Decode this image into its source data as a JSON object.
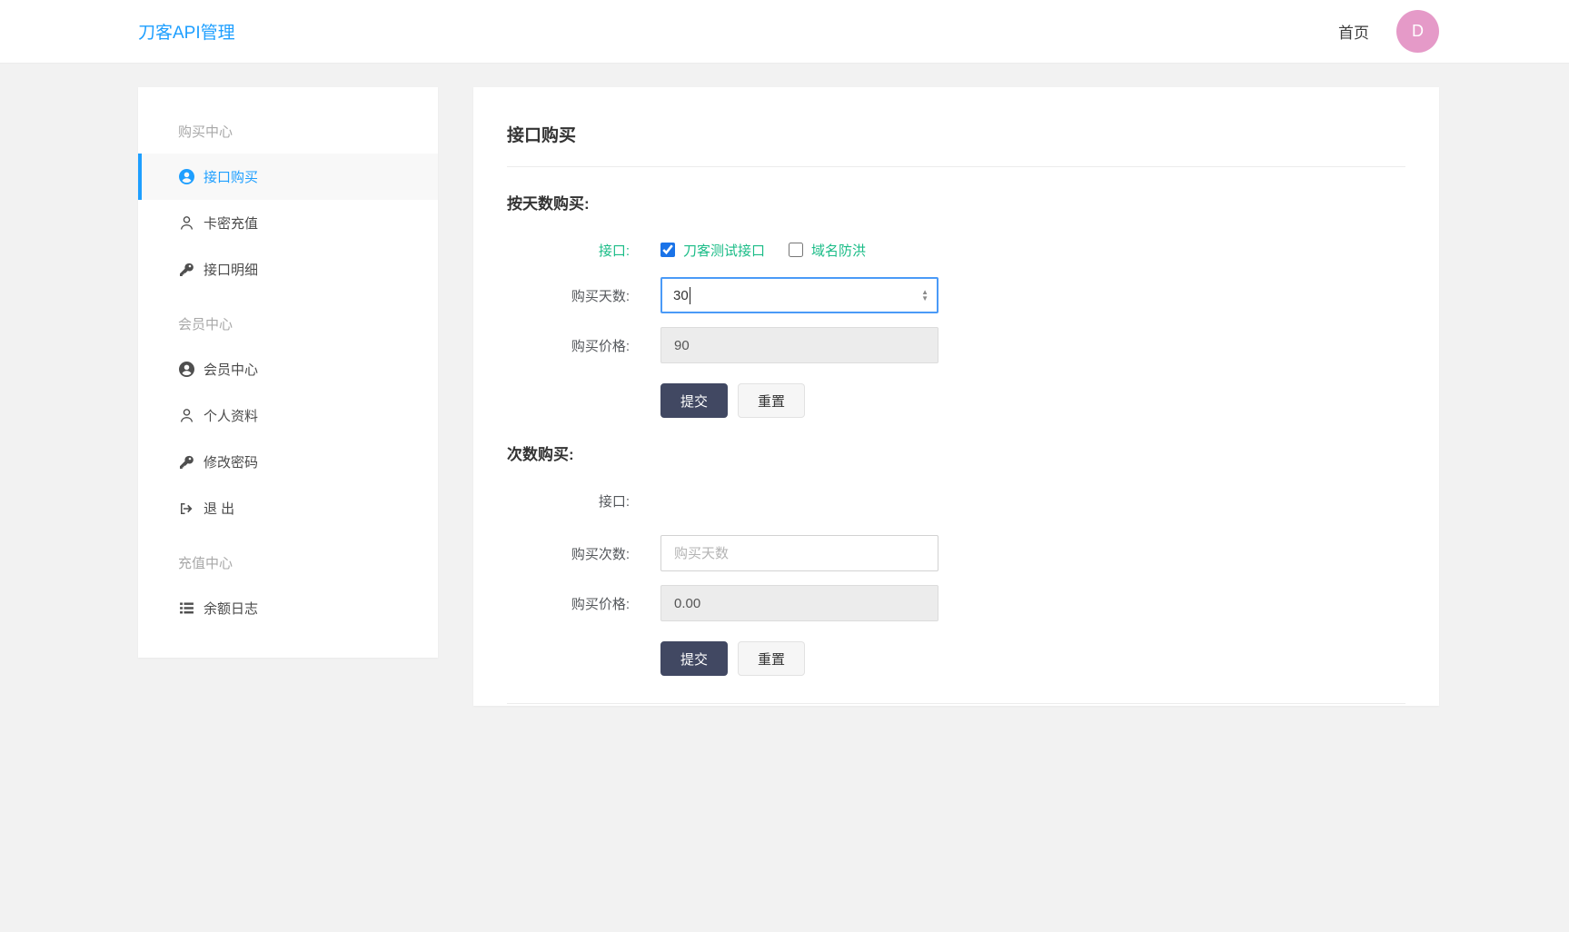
{
  "navbar": {
    "brand": "刀客API管理",
    "home_link": "首页",
    "avatar_initial": "D"
  },
  "sidebar": {
    "sections": [
      {
        "title": "购买中心",
        "items": [
          {
            "label": "接口购买",
            "icon": "user-circle-icon",
            "active": true
          },
          {
            "label": "卡密充值",
            "icon": "user-icon",
            "active": false
          },
          {
            "label": "接口明细",
            "icon": "key-icon",
            "active": false
          }
        ]
      },
      {
        "title": "会员中心",
        "items": [
          {
            "label": "会员中心",
            "icon": "user-circle-icon",
            "active": false
          },
          {
            "label": "个人资料",
            "icon": "user-icon",
            "active": false
          },
          {
            "label": "修改密码",
            "icon": "key-icon",
            "active": false
          },
          {
            "label": "退 出",
            "icon": "sign-out-icon",
            "active": false
          }
        ]
      },
      {
        "title": "充值中心",
        "items": [
          {
            "label": "余额日志",
            "icon": "list-icon",
            "active": false
          }
        ]
      }
    ]
  },
  "main": {
    "title": "接口购买",
    "day_section": {
      "heading": "按天数购买:",
      "api_label": "接口:",
      "options": [
        {
          "label": "刀客测试接口",
          "checked": true
        },
        {
          "label": "域名防洪",
          "checked": false
        }
      ],
      "days_label": "购买天数:",
      "days_value": "30",
      "price_label": "购买价格:",
      "price_value": "90",
      "submit_label": "提交",
      "reset_label": "重置"
    },
    "count_section": {
      "heading": "次数购买:",
      "api_label": "接口:",
      "count_label": "购买次数:",
      "count_placeholder": "购买天数",
      "count_value": "",
      "price_label": "购买价格:",
      "price_value": "0.00",
      "submit_label": "提交",
      "reset_label": "重置"
    }
  },
  "colors": {
    "brand_blue": "#1e9fff",
    "link_green": "#1abc87",
    "submit_dark": "#414862",
    "avatar_pink": "#e59ac8",
    "focus_border_blue": "#4a9af7"
  }
}
